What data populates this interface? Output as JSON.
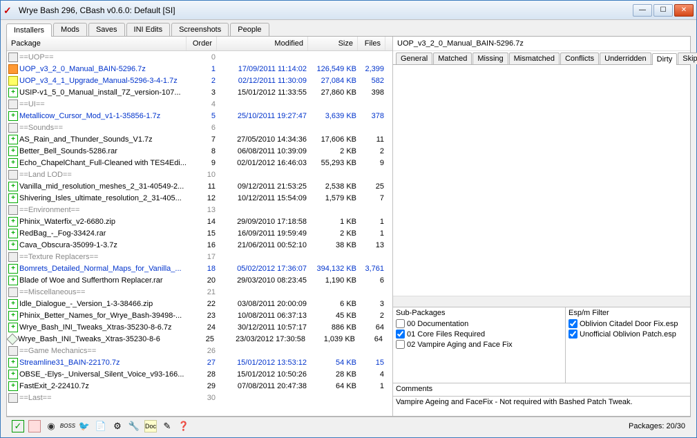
{
  "window": {
    "title": "Wrye Bash 296, CBash v0.6.0: Default [SI]"
  },
  "tabs": [
    "Installers",
    "Mods",
    "Saves",
    "INI Edits",
    "Screenshots",
    "People"
  ],
  "activeTab": 0,
  "columns": {
    "package": "Package",
    "order": "Order",
    "modified": "Modified",
    "size": "Size",
    "files": "Files"
  },
  "rows": [
    {
      "icon": "marker",
      "cls": "grey",
      "name": "==UOP==",
      "order": "0",
      "mod": "",
      "size": "",
      "files": ""
    },
    {
      "icon": "orange",
      "cls": "blue",
      "name": "UOP_v3_2_0_Manual_BAIN-5296.7z",
      "order": "1",
      "mod": "17/09/2011 11:14:02",
      "size": "126,549 KB",
      "files": "2,399"
    },
    {
      "icon": "yellow",
      "cls": "blue",
      "name": "UOP_v3_4_1_Upgrade_Manual-5296-3-4-1.7z",
      "order": "2",
      "mod": "02/12/2011 11:30:09",
      "size": "27,084 KB",
      "files": "582"
    },
    {
      "icon": "plus",
      "cls": "",
      "name": "USIP-v1_5_0_Manual_install_7Z_version-107...",
      "order": "3",
      "mod": "15/01/2012 11:33:55",
      "size": "27,860 KB",
      "files": "398"
    },
    {
      "icon": "marker",
      "cls": "grey",
      "name": "==UI==",
      "order": "4",
      "mod": "",
      "size": "",
      "files": ""
    },
    {
      "icon": "plus",
      "cls": "blue",
      "name": "Metallicow_Cursor_Mod_v1-1-35856-1.7z",
      "order": "5",
      "mod": "25/10/2011 19:27:47",
      "size": "3,639 KB",
      "files": "378"
    },
    {
      "icon": "marker",
      "cls": "grey",
      "name": "==Sounds==",
      "order": "6",
      "mod": "",
      "size": "",
      "files": ""
    },
    {
      "icon": "plus",
      "cls": "",
      "name": "AS_Rain_and_Thunder_Sounds_V1.7z",
      "order": "7",
      "mod": "27/05/2010 14:34:36",
      "size": "17,606 KB",
      "files": "11"
    },
    {
      "icon": "plus",
      "cls": "",
      "name": "Better_Bell_Sounds-5286.rar",
      "order": "8",
      "mod": "06/08/2011 10:39:09",
      "size": "2 KB",
      "files": "2"
    },
    {
      "icon": "plus",
      "cls": "",
      "name": "Echo_ChapelChant_Full-Cleaned with TES4Edi...",
      "order": "9",
      "mod": "02/01/2012 16:46:03",
      "size": "55,293 KB",
      "files": "9"
    },
    {
      "icon": "marker",
      "cls": "grey",
      "name": "==Land LOD==",
      "order": "10",
      "mod": "",
      "size": "",
      "files": ""
    },
    {
      "icon": "plus",
      "cls": "",
      "name": "Vanilla_mid_resolution_meshes_2_31-40549-2...",
      "order": "11",
      "mod": "09/12/2011 21:53:25",
      "size": "2,538 KB",
      "files": "25"
    },
    {
      "icon": "plus",
      "cls": "",
      "name": "Shivering_Isles_ultimate_resolution_2_31-405...",
      "order": "12",
      "mod": "10/12/2011 15:54:09",
      "size": "1,579 KB",
      "files": "7"
    },
    {
      "icon": "marker",
      "cls": "grey",
      "name": "==Environment==",
      "order": "13",
      "mod": "",
      "size": "",
      "files": ""
    },
    {
      "icon": "plus",
      "cls": "",
      "name": "Phinix_Waterfix_v2-6680.zip",
      "order": "14",
      "mod": "29/09/2010 17:18:58",
      "size": "1 KB",
      "files": "1"
    },
    {
      "icon": "plus",
      "cls": "",
      "name": "RedBag_-_Fog-33424.rar",
      "order": "15",
      "mod": "16/09/2011 19:59:49",
      "size": "2 KB",
      "files": "1"
    },
    {
      "icon": "plus",
      "cls": "",
      "name": "Cava_Obscura-35099-1-3.7z",
      "order": "16",
      "mod": "21/06/2011 00:52:10",
      "size": "38 KB",
      "files": "13"
    },
    {
      "icon": "marker",
      "cls": "grey",
      "name": "==Texture Replacers==",
      "order": "17",
      "mod": "",
      "size": "",
      "files": ""
    },
    {
      "icon": "plus",
      "cls": "blue",
      "name": "Bomrets_Detailed_Normal_Maps_for_Vanilla_...",
      "order": "18",
      "mod": "05/02/2012 17:36:07",
      "size": "394,132 KB",
      "files": "3,761"
    },
    {
      "icon": "plus",
      "cls": "",
      "name": "Blade of Woe and Sufferthorn Replacer.rar",
      "order": "20",
      "mod": "29/03/2010 08:23:45",
      "size": "1,190 KB",
      "files": "6"
    },
    {
      "icon": "marker",
      "cls": "grey",
      "name": "==Miscellaneous==",
      "order": "21",
      "mod": "",
      "size": "",
      "files": ""
    },
    {
      "icon": "plus",
      "cls": "",
      "name": "Idle_Dialogue_-_Version_1-3-38466.zip",
      "order": "22",
      "mod": "03/08/2011 20:00:09",
      "size": "6 KB",
      "files": "3"
    },
    {
      "icon": "plus",
      "cls": "",
      "name": "Phinix_Better_Names_for_Wrye_Bash-39498-...",
      "order": "23",
      "mod": "10/08/2011 06:37:13",
      "size": "45 KB",
      "files": "2"
    },
    {
      "icon": "plus",
      "cls": "",
      "name": "Wrye_Bash_INI_Tweaks_Xtras-35230-8-6.7z",
      "order": "24",
      "mod": "30/12/2011 10:57:17",
      "size": "886 KB",
      "files": "64"
    },
    {
      "icon": "diamond",
      "cls": "",
      "name": "Wrye_Bash_INI_Tweaks_Xtras-35230-8-6",
      "order": "25",
      "mod": "23/03/2012 17:30:58",
      "size": "1,039 KB",
      "files": "64"
    },
    {
      "icon": "marker",
      "cls": "grey",
      "name": "==Game Mechanics==",
      "order": "26",
      "mod": "",
      "size": "",
      "files": ""
    },
    {
      "icon": "plus",
      "cls": "blue",
      "name": "Streamline31_BAIN-22170.7z",
      "order": "27",
      "mod": "15/01/2012 13:53:12",
      "size": "54 KB",
      "files": "15"
    },
    {
      "icon": "plus",
      "cls": "",
      "name": "OBSE_-Elys-_Universal_Silent_Voice_v93-166...",
      "order": "28",
      "mod": "15/01/2012 10:50:26",
      "size": "28 KB",
      "files": "4"
    },
    {
      "icon": "plus",
      "cls": "",
      "name": "FastExit_2-22410.7z",
      "order": "29",
      "mod": "07/08/2011 20:47:38",
      "size": "64 KB",
      "files": "1"
    },
    {
      "icon": "marker",
      "cls": "grey",
      "name": "==Last==",
      "order": "30",
      "mod": "",
      "size": "",
      "files": ""
    }
  ],
  "detail": {
    "title": "UOP_v3_2_0_Manual_BAIN-5296.7z",
    "tabs": [
      "General",
      "Matched",
      "Missing",
      "Mismatched",
      "Conflicts",
      "Underridden",
      "Dirty",
      "Skipped"
    ],
    "activeTab": 6,
    "subPackages": {
      "label": "Sub-Packages",
      "items": [
        {
          "checked": false,
          "label": "00 Documentation"
        },
        {
          "checked": true,
          "label": "01 Core Files Required"
        },
        {
          "checked": false,
          "label": "02 Vampire Aging and Face Fix"
        }
      ]
    },
    "espFilter": {
      "label": "Esp/m Filter",
      "items": [
        {
          "checked": true,
          "label": "Oblivion Citadel Door Fix.esp"
        },
        {
          "checked": true,
          "label": "Unofficial Oblivion Patch.esp"
        }
      ]
    },
    "comments": {
      "label": "Comments",
      "text": "Vampire Ageing and FaceFix - Not required with Bashed Patch Tweak."
    }
  },
  "status": {
    "packages": "Packages: 20/30"
  }
}
